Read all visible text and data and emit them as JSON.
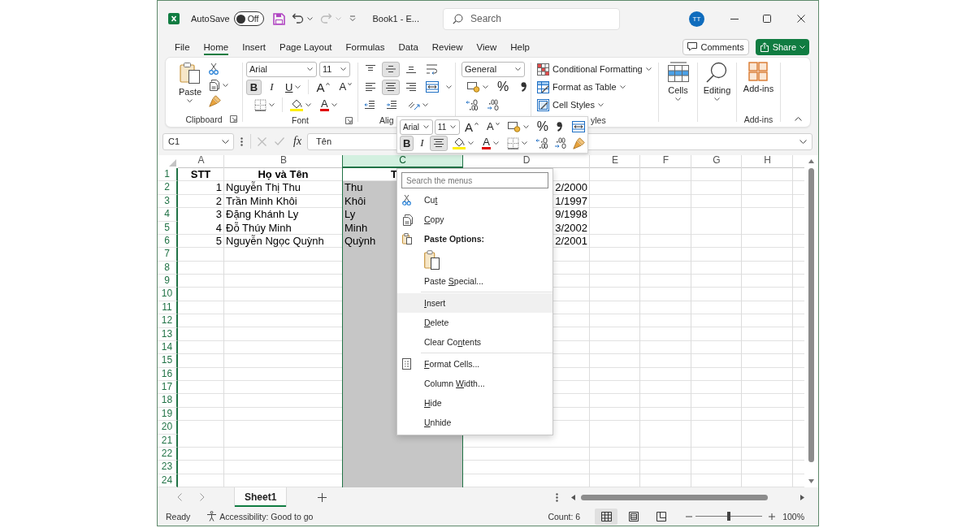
{
  "title_bar": {
    "autosave": {
      "label": "AutoSave",
      "on": false,
      "state": "Off"
    },
    "document_title": "Book1 - E...",
    "search": {
      "placeholder": "Search"
    },
    "account": {
      "initials": "TT"
    }
  },
  "ribbon": {
    "tabs": [
      {
        "label": "File",
        "selected": false
      },
      {
        "label": "Home",
        "selected": true
      },
      {
        "label": "Insert",
        "selected": false
      },
      {
        "label": "Page Layout",
        "selected": false
      },
      {
        "label": "Formulas",
        "selected": false
      },
      {
        "label": "Data",
        "selected": false
      },
      {
        "label": "Review",
        "selected": false
      },
      {
        "label": "View",
        "selected": false
      },
      {
        "label": "Help",
        "selected": false
      }
    ],
    "comments_button": "Comments",
    "share_button": "Share",
    "clipboard": {
      "paste": "Paste",
      "group_label": "Clipboard"
    },
    "font": {
      "font_name": "Arial",
      "font_size": "11",
      "bold": {
        "label": "B",
        "selected": true
      },
      "italic": {
        "label": "I",
        "selected": false
      },
      "underline": {
        "label": "U",
        "selected": false
      },
      "grow_font": "A",
      "shrink_font": "A",
      "font_color": "A",
      "group_label": "Font"
    },
    "alignment": {
      "vertical": [
        {
          "kind": "top",
          "selected": false
        },
        {
          "kind": "middle",
          "selected": true
        },
        {
          "kind": "bottom",
          "selected": false
        }
      ],
      "horizontal": [
        {
          "kind": "left",
          "selected": false
        },
        {
          "kind": "center",
          "selected": true
        },
        {
          "kind": "right",
          "selected": false
        }
      ],
      "group_label": "Alig"
    },
    "number": {
      "format": "General",
      "percent": "%"
    },
    "styles": {
      "commands": [
        {
          "kind": "conditional",
          "label": "Conditional Formatting"
        },
        {
          "kind": "table",
          "label": "Format as Table"
        },
        {
          "kind": "cell_styles",
          "label": "Cell Styles"
        }
      ],
      "group_label": "yles"
    },
    "cells": {
      "label": "Cells"
    },
    "editing": {
      "label": "Editing"
    },
    "add_ins": {
      "label": "Add-ins",
      "group_label": "Add-ins"
    }
  },
  "mini_toolbar": {
    "font_name": "Arial",
    "font_size": "11",
    "grow_font": "A",
    "shrink_font": "A",
    "percent": "%",
    "bold": {
      "label": "B",
      "selected": true
    },
    "italic": {
      "label": "I",
      "selected": false
    },
    "center": {
      "selected": true
    },
    "font_color": "A"
  },
  "formula_bar": {
    "name_box": "C1",
    "function_label": "fx",
    "content": "Tên"
  },
  "sheet": {
    "columns": [
      {
        "label": "A",
        "selected": false
      },
      {
        "label": "B",
        "selected": false
      },
      {
        "label": "C",
        "selected": true
      },
      {
        "label": "D",
        "selected": false
      },
      {
        "label": "E",
        "selected": false
      },
      {
        "label": "F",
        "selected": false
      },
      {
        "label": "G",
        "selected": false
      },
      {
        "label": "H",
        "selected": false
      }
    ],
    "rows": [
      {
        "number": "1",
        "kind": "header",
        "a": "STT",
        "b": "Họ và Tên",
        "c": "T"
      },
      {
        "number": "2",
        "kind": "data",
        "a": "1",
        "b": "Nguyễn Thị Thu",
        "c": "Thu",
        "d": "2/2000"
      },
      {
        "number": "3",
        "kind": "data",
        "a": "2",
        "b": "Trần Minh Khôi",
        "c": "Khôi",
        "d": "1/1997"
      },
      {
        "number": "4",
        "kind": "data",
        "a": "3",
        "b": "Đặng Khánh Ly",
        "c": "Ly",
        "d": "9/1998"
      },
      {
        "number": "5",
        "kind": "data",
        "a": "4",
        "b": "Đỗ Thúy Minh",
        "c": "Minh",
        "d": "3/2002"
      },
      {
        "number": "6",
        "kind": "data",
        "a": "5",
        "b": "Nguyễn Ngọc Quỳnh",
        "c": "Quỳnh",
        "d": "2/2001"
      },
      {
        "number": "7",
        "kind": "data"
      },
      {
        "number": "8",
        "kind": "data"
      },
      {
        "number": "9",
        "kind": "data"
      },
      {
        "number": "10",
        "kind": "data"
      },
      {
        "number": "11",
        "kind": "data"
      },
      {
        "number": "12",
        "kind": "data"
      },
      {
        "number": "13",
        "kind": "data"
      },
      {
        "number": "14",
        "kind": "data"
      },
      {
        "number": "15",
        "kind": "data"
      },
      {
        "number": "16",
        "kind": "data"
      },
      {
        "number": "17",
        "kind": "data"
      },
      {
        "number": "18",
        "kind": "data"
      },
      {
        "number": "19",
        "kind": "data"
      },
      {
        "number": "20",
        "kind": "data"
      },
      {
        "number": "21",
        "kind": "data"
      },
      {
        "number": "22",
        "kind": "data"
      },
      {
        "number": "23",
        "kind": "data"
      },
      {
        "number": "24",
        "kind": "data"
      }
    ]
  },
  "context_menu": {
    "search": {
      "placeholder": "Search the menus"
    },
    "items": [
      {
        "kind": "cut",
        "before": "Cu",
        "key": "t",
        "selected": false
      },
      {
        "kind": "copy",
        "key": "C",
        "after": "opy",
        "selected": false
      },
      {
        "kind": "heading",
        "label": "Paste Options:"
      },
      {
        "kind": "paste_option"
      },
      {
        "kind": "command",
        "before": "Paste ",
        "key": "S",
        "after": "pecial...",
        "selected": false
      },
      {
        "kind": "separator"
      },
      {
        "kind": "command",
        "key": "I",
        "after": "nsert",
        "selected": true
      },
      {
        "kind": "command",
        "key": "D",
        "after": "elete",
        "selected": false
      },
      {
        "kind": "command",
        "before": "Clear Co",
        "key": "n",
        "after": "tents",
        "selected": false
      },
      {
        "kind": "separator"
      },
      {
        "kind": "format_cells",
        "key": "F",
        "after": "ormat Cells...",
        "selected": false
      },
      {
        "kind": "command",
        "before": "Column ",
        "key": "W",
        "after": "idth...",
        "selected": false
      },
      {
        "kind": "command",
        "key": "H",
        "after": "ide",
        "selected": false
      },
      {
        "kind": "command",
        "key": "U",
        "after": "nhide",
        "selected": false
      }
    ]
  },
  "sheet_tabs": [
    {
      "label": "Sheet1",
      "selected": true
    }
  ],
  "status_bar": {
    "status": "Ready",
    "accessibility": "Accessibility: Good to go",
    "count": "Count: 6",
    "views": [
      {
        "kind": "normal",
        "selected": true
      },
      {
        "kind": "page_layout",
        "selected": false
      },
      {
        "kind": "page_break",
        "selected": false
      }
    ],
    "zoom": {
      "level": 0.5,
      "reading": "100%"
    }
  }
}
